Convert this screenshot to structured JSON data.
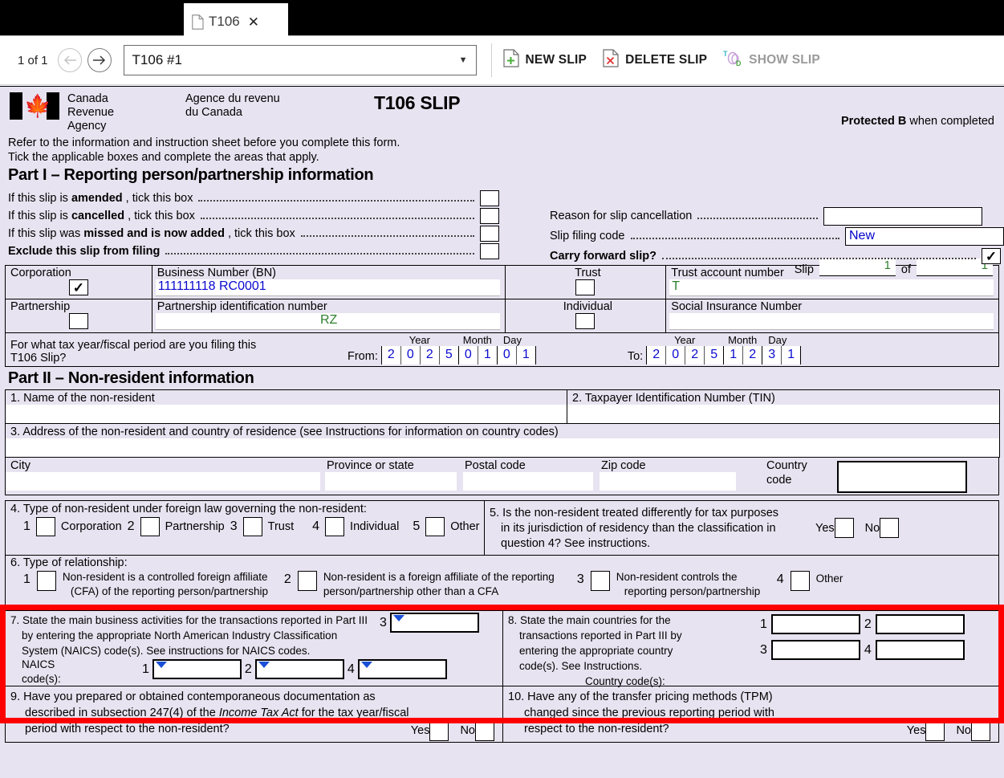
{
  "window": {
    "tab": {
      "label": "T106",
      "icon": "document-icon",
      "close": "✕"
    }
  },
  "toolbar": {
    "pager": "1 of 1",
    "prev_icon": "arrow-left-icon",
    "next_icon": "arrow-right-icon",
    "slip_selector_value": "T106 #1",
    "dropdown_arrow": "▼",
    "new_slip": "NEW SLIP",
    "delete_slip": "DELETE SLIP",
    "show_slip": "SHOW SLIP"
  },
  "form": {
    "agency_en": "Canada Revenue\nAgency",
    "agency_en_l1": "Canada Revenue",
    "agency_en_l2": "Agency",
    "agency_fr_l1": "Agence du revenu",
    "agency_fr_l2": "du Canada",
    "title": "T106 SLIP",
    "protected_bold": "Protected B",
    "protected_rest": " when completed",
    "instruction_l1": "Refer to the information and instruction sheet before you complete this form.",
    "instruction_l2": "Tick the applicable boxes and complete the areas that apply.",
    "part1_heading": "Part I – Reporting person/partnership information",
    "slip_label": "Slip",
    "slip_of": "of",
    "slip_number": "1",
    "slip_total": "1",
    "rows": [
      {
        "pre": "If this slip is ",
        "bold": "amended",
        "post": " , tick this box",
        "checked": false
      },
      {
        "pre": "If this slip is ",
        "bold": "cancelled",
        "post": " , tick this box",
        "checked": false
      },
      {
        "pre": "If this slip was ",
        "bold": "missed and is now added",
        "post": " , tick this box",
        "checked": false
      },
      {
        "pre": "",
        "bold": "Exclude this slip from filing",
        "post": "",
        "checked": false
      }
    ],
    "reason_label": "Reason for slip cancellation",
    "reason_value": "",
    "filing_code_label": "Slip filing code",
    "filing_code_value": "New",
    "carry_forward_label": "Carry forward slip?",
    "carry_forward_checked": true,
    "entities": {
      "corporation": {
        "label": "Corporation",
        "checked": true
      },
      "partnership": {
        "label": "Partnership",
        "checked": false
      },
      "trust": {
        "label": "Trust",
        "checked": false
      },
      "individual": {
        "label": "Individual",
        "checked": false
      },
      "bn_label": "Business Number (BN)",
      "bn_value": "111111118 RC0001",
      "pin_label": "Partnership identification number",
      "pin_value": "RZ",
      "trust_label": "Trust account number",
      "trust_value": "T",
      "sin_label": "Social Insurance Number",
      "sin_value": ""
    },
    "period": {
      "question_l1": "For what tax year/fiscal period are you filing this",
      "question_l2": "T106 Slip?",
      "from_label": "From:",
      "to_label": "To:",
      "year_label": "Year",
      "month_label": "Month",
      "day_label": "Day",
      "from_year": [
        "2",
        "0",
        "2",
        "5"
      ],
      "from_month": [
        "0",
        "1"
      ],
      "from_day": [
        "0",
        "1"
      ],
      "to_year": [
        "2",
        "0",
        "2",
        "5"
      ],
      "to_month": [
        "1",
        "2"
      ],
      "to_day": [
        "3",
        "1"
      ]
    },
    "part2_heading": "Part II – Non-resident information",
    "q1_label": "1. Name of the non-resident",
    "q1_value": "",
    "q2_label": "2. Taxpayer Identification Number (TIN)",
    "q2_value": "",
    "q3_label": "3. Address of the non-resident and country of residence (see Instructions for information on country codes)",
    "q3_value": "",
    "city_label": "City",
    "city_value": "",
    "province_label": "Province or state",
    "province_value": "",
    "postal_label": "Postal code",
    "postal_value": "",
    "zip_label": "Zip code",
    "zip_value": "",
    "country_code_label_l1": "Country",
    "country_code_label_l2": "code",
    "country_code_value": "",
    "q4": {
      "heading": "4. Type of non-resident under foreign law governing the non-resident:",
      "options": [
        {
          "num": "1",
          "label": "Corporation",
          "checked": false
        },
        {
          "num": "2",
          "label": "Partnership",
          "checked": false
        },
        {
          "num": "3",
          "label": "Trust",
          "checked": false
        },
        {
          "num": "4",
          "label": "Individual",
          "checked": false
        },
        {
          "num": "5",
          "label": "Other",
          "checked": false
        }
      ]
    },
    "q5": {
      "line1": "5. Is the non-resident treated differently for tax purposes",
      "line2": "in its jurisdiction of residency than the classification in",
      "line3": "question 4? See instructions.",
      "yes_label": "Yes",
      "no_label": "No",
      "yes_checked": false,
      "no_checked": false
    },
    "q6": {
      "heading": "6. Type of relationship:",
      "options": [
        {
          "num": "1",
          "l1": "Non-resident is a controlled foreign affiliate",
          "l2": "(CFA) of the reporting person/partnership",
          "checked": false
        },
        {
          "num": "2",
          "l1": "Non-resident is a foreign affiliate of the reporting",
          "l2": "person/partnership other than a CFA",
          "checked": false
        },
        {
          "num": "3",
          "l1": "Non-resident controls the",
          "l2": "reporting person/partnership",
          "checked": false
        },
        {
          "num": "4",
          "l1": "Other",
          "l2": "",
          "checked": false
        }
      ]
    },
    "q7": {
      "l1": "7. State the main business activities for the transactions reported in Part III",
      "l2": "by entering the appropriate North American Industry Classification",
      "l3": "System (NAICS) code(s). See instructions for NAICS codes.",
      "field_label_l1": "NAICS",
      "field_label_l2": "code(s):",
      "codes": [
        {
          "num": "1",
          "value": ""
        },
        {
          "num": "2",
          "value": ""
        },
        {
          "num": "3",
          "value": ""
        },
        {
          "num": "4",
          "value": ""
        }
      ]
    },
    "q8": {
      "l1": "8. State the main countries for the",
      "l2": "transactions reported in Part III by",
      "l3": "entering the appropriate country",
      "l4": "code(s). See Instructions.",
      "field_label": "Country code(s):",
      "codes": [
        {
          "num": "1",
          "value": ""
        },
        {
          "num": "2",
          "value": ""
        },
        {
          "num": "3",
          "value": ""
        },
        {
          "num": "4",
          "value": ""
        }
      ]
    },
    "q9": {
      "l1": "9. Have you prepared or obtained contemporaneous documentation as",
      "l2a": "described in subsection 247(4) of the ",
      "l2i": "Income Tax Act",
      "l2b": " for the tax year/fiscal",
      "l3": "period with respect to the non-resident?",
      "yes_label": "Yes",
      "no_label": "No",
      "yes_checked": false,
      "no_checked": false
    },
    "q10": {
      "l1": "10. Have any of the transfer pricing methods (TPM)",
      "l2": "changed since the previous reporting period with",
      "l3": "respect to the non-resident?",
      "yes_label": "Yes",
      "no_label": "No",
      "yes_checked": false,
      "no_checked": false
    }
  },
  "colors": {
    "form_bg": "#e8e3f0",
    "highlight": "#ff0000",
    "entry_blue": "#0a0ad0",
    "entry_green": "#2f7f2f",
    "new_slip_green": "#4caf3f",
    "delete_red": "#e03b3b"
  }
}
